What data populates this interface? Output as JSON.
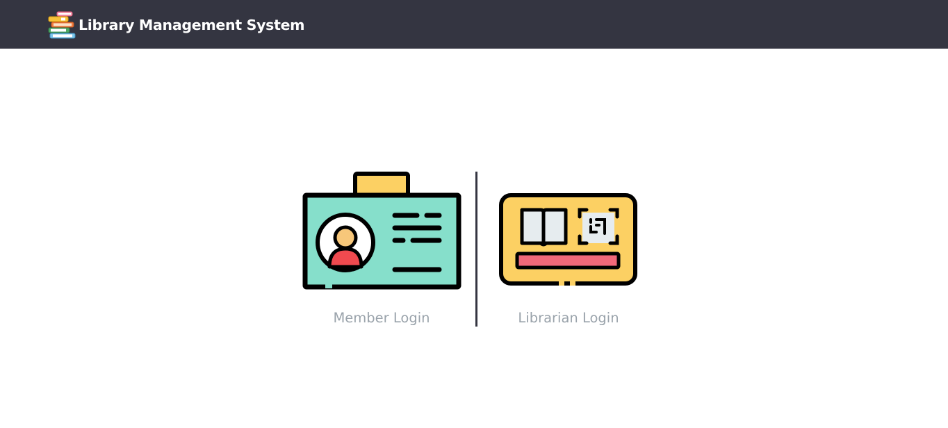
{
  "header": {
    "brand_title": "Library Management System",
    "brand_icon": "book-stack-icon",
    "background_color": "#343541"
  },
  "login_options": {
    "member": {
      "label": "Member Login",
      "icon": "id-card-icon"
    },
    "librarian": {
      "label": "Librarian Login",
      "icon": "library-card-icon"
    }
  },
  "colors": {
    "member_card": "#86dfcb",
    "librarian_card": "#fcd063",
    "accent_red": "#f04a4f",
    "label_text": "#9aa3ab"
  }
}
